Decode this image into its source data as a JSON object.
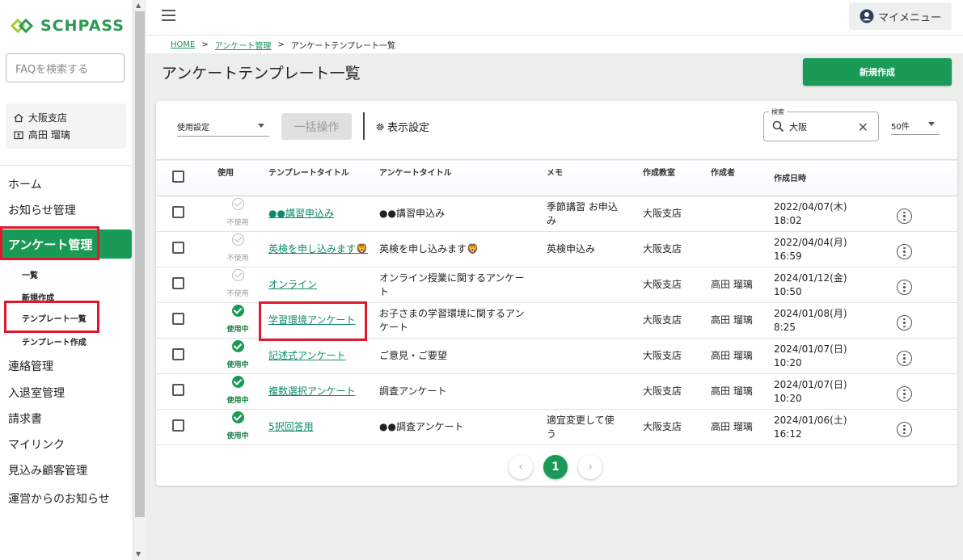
{
  "app": {
    "logo_text": "SCHPASS"
  },
  "sidebar": {
    "faq_placeholder": "FAQを検索する",
    "branch": "大阪支店",
    "user": "高田 瑠璃",
    "nav": [
      {
        "label": "ホーム"
      },
      {
        "label": "お知らせ管理"
      },
      {
        "label": "アンケート管理"
      },
      {
        "label": "連絡管理"
      },
      {
        "label": "入退室管理"
      },
      {
        "label": "請求書"
      },
      {
        "label": "マイリンク"
      },
      {
        "label": "見込み顧客管理"
      },
      {
        "label": "運営からのお知らせ"
      }
    ],
    "subnav": [
      {
        "label": "一覧"
      },
      {
        "label": "新規作成"
      },
      {
        "label": "テンプレート一覧"
      },
      {
        "label": "テンプレート作成"
      }
    ]
  },
  "header": {
    "mymenu": "マイメニュー"
  },
  "breadcrumb": {
    "home": "HOME",
    "survey": "アンケート管理",
    "current": "アンケートテンプレート一覧"
  },
  "page": {
    "title": "アンケートテンプレート一覧",
    "new_button": "新規作成"
  },
  "toolbar": {
    "use_setting": "使用設定",
    "bulk": "一括操作",
    "display_setting": "表示設定",
    "search_label": "検索",
    "search_value": "大阪",
    "per_page": "50件"
  },
  "table": {
    "headers": [
      "使用",
      "テンプレートタイトル",
      "アンケートタイトル",
      "メモ",
      "作成教室",
      "作成者",
      "作成日時"
    ],
    "rows": [
      {
        "use": "不使用",
        "active": false,
        "template": "●●講習申込み",
        "survey": "●●講習申込み",
        "memo": "季節講習 お申込み",
        "classroom": "大阪支店",
        "creator": "",
        "date": "2022/04/07(木) 18:02"
      },
      {
        "use": "不使用",
        "active": false,
        "template": "英検を申し込みます🦁",
        "survey": "英検を申し込みます🦁",
        "memo": "英検申込み",
        "classroom": "大阪支店",
        "creator": "",
        "date": "2022/04/04(月) 16:59"
      },
      {
        "use": "不使用",
        "active": false,
        "template": "オンライン",
        "survey": "オンライン授業に関するアンケート",
        "memo": "",
        "classroom": "大阪支店",
        "creator": "高田 瑠璃",
        "date": "2024/01/12(金) 10:50"
      },
      {
        "use": "使用中",
        "active": true,
        "template": "学習環境アンケート",
        "survey": "お子さまの学習環境に関するアンケート",
        "memo": "",
        "classroom": "大阪支店",
        "creator": "高田 瑠璃",
        "date": "2024/01/08(月) 8:25"
      },
      {
        "use": "使用中",
        "active": true,
        "template": "記述式アンケート",
        "survey": "ご意見・ご要望",
        "memo": "",
        "classroom": "大阪支店",
        "creator": "高田 瑠璃",
        "date": "2024/01/07(日) 10:20"
      },
      {
        "use": "使用中",
        "active": true,
        "template": "複数選択アンケート",
        "survey": "調査アンケート",
        "memo": "",
        "classroom": "大阪支店",
        "creator": "高田 瑠璃",
        "date": "2024/01/07(日) 10:20"
      },
      {
        "use": "使用中",
        "active": true,
        "template": "5択回答用",
        "survey": "●●調査アンケート",
        "memo": "適宜変更して使う",
        "classroom": "大阪支店",
        "creator": "高田 瑠璃",
        "date": "2024/01/06(土) 16:12"
      }
    ]
  },
  "pagination": {
    "current": "1",
    "prev": "‹",
    "next": "›"
  },
  "colors": {
    "brand": "#199a56",
    "highlight": "#e0182d",
    "link": "#0e8a6b"
  }
}
